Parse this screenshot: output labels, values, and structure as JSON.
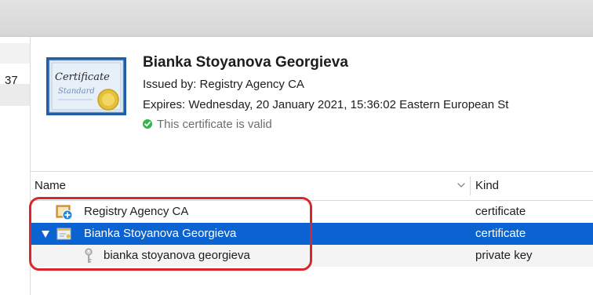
{
  "left_panel": {
    "number": "37"
  },
  "certificate": {
    "image_texts": {
      "line1": "Certificate",
      "line2": "Standard"
    },
    "name": "Bianka Stoyanova Georgieva",
    "issued_by": "Issued by: Registry Agency CA",
    "expires": "Expires: Wednesday, 20 January 2021, 15:36:02 Eastern European St",
    "status": "This certificate is valid"
  },
  "table": {
    "columns": {
      "name": "Name",
      "kind": "Kind"
    },
    "rows": [
      {
        "label": "Registry Agency CA",
        "kind": "certificate",
        "icon": "certificate-authority-icon"
      },
      {
        "label": "Bianka Stoyanova Georgieva",
        "kind": "certificate",
        "icon": "certificate-icon",
        "selected": true,
        "expanded": true
      },
      {
        "label": "bianka stoyanova georgieva",
        "kind": "private key",
        "icon": "key-icon"
      }
    ]
  },
  "colors": {
    "selection": "#0a63d1",
    "valid": "#32b64a",
    "highlight": "#d9262d"
  }
}
